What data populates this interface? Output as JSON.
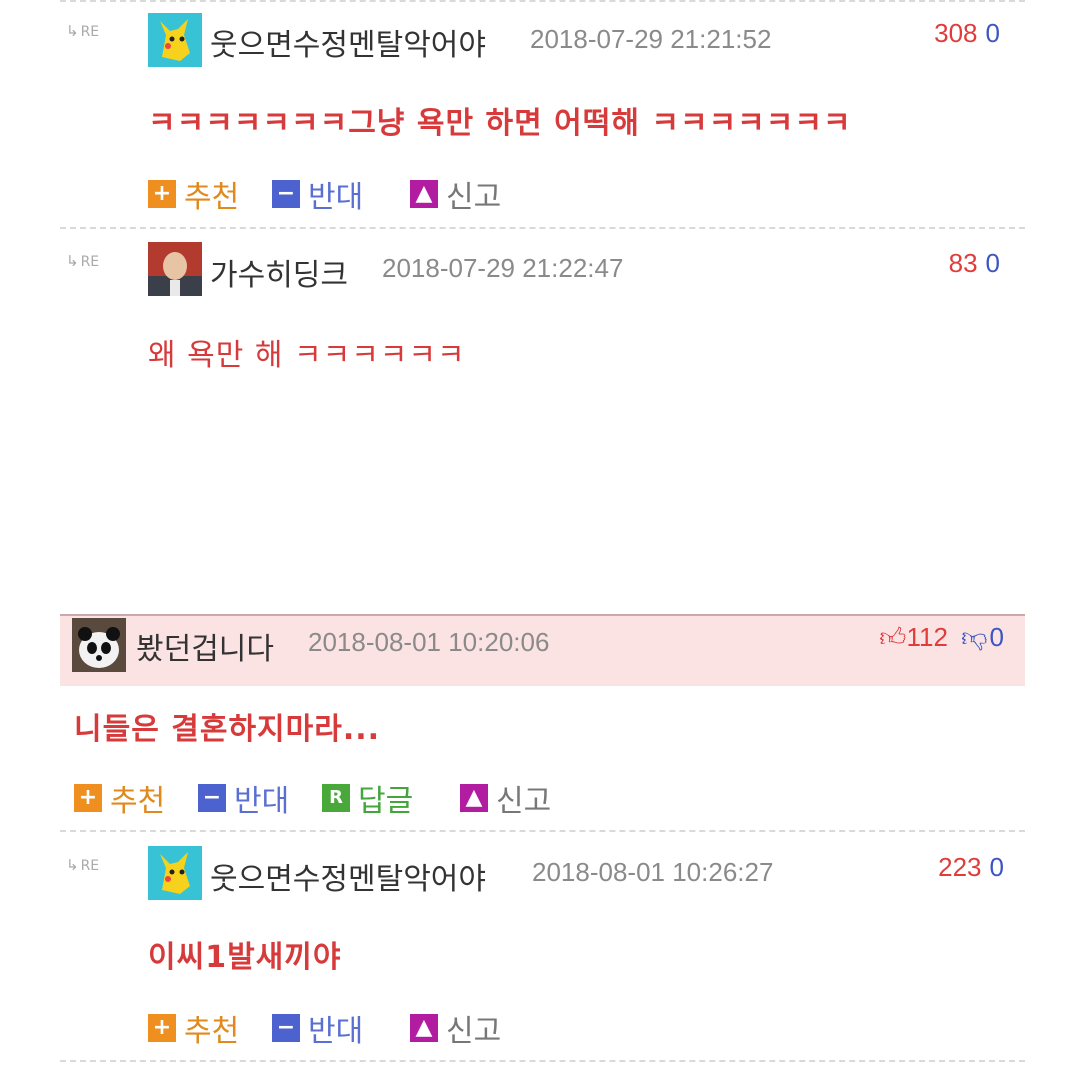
{
  "re_label": "RE",
  "actions": {
    "recommend": "추천",
    "oppose": "반대",
    "reply": "답글",
    "report": "신고"
  },
  "comments": [
    {
      "nick": "웃으면수정멘탈악어야",
      "date": "2018-07-29 21:21:52",
      "up": "308",
      "down": "0",
      "text": "ㅋㅋㅋㅋㅋㅋㅋ그냥 욕만 하면 어떡해 ㅋㅋㅋㅋㅋㅋㅋ"
    },
    {
      "nick": "가수히딩크",
      "date": "2018-07-29 21:22:47",
      "up": "83",
      "down": "0",
      "text": "왜 욕만 해 ㅋㅋㅋㅋㅋㅋ"
    },
    {
      "nick": "봤던겁니다",
      "date": "2018-08-01 10:20:06",
      "up": "112",
      "down": "0",
      "text": "니들은 결혼하지마라..."
    },
    {
      "nick": "웃으면수정멘탈악어야",
      "date": "2018-08-01 10:26:27",
      "up": "223",
      "down": "0",
      "text": "이씨1발새끼야"
    }
  ]
}
